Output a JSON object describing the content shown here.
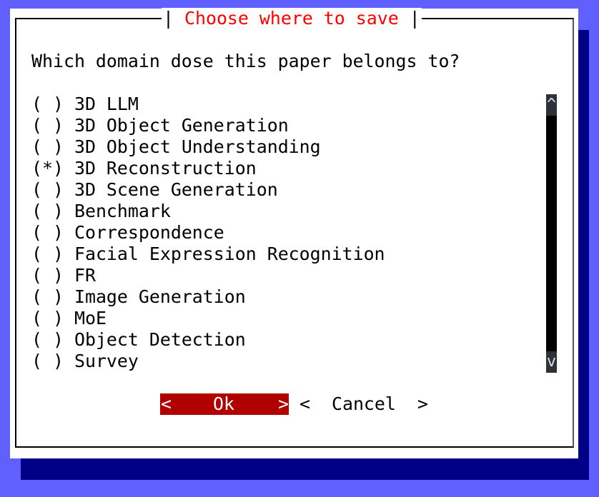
{
  "dialog": {
    "title": "Choose where to save",
    "prompt": "Which domain dose this paper belongs to?",
    "options": [
      {
        "label": "3D LLM",
        "selected": false
      },
      {
        "label": "3D Object Generation",
        "selected": false
      },
      {
        "label": "3D Object Understanding",
        "selected": false
      },
      {
        "label": "3D Reconstruction",
        "selected": true
      },
      {
        "label": "3D Scene Generation",
        "selected": false
      },
      {
        "label": "Benchmark",
        "selected": false
      },
      {
        "label": "Correspondence",
        "selected": false
      },
      {
        "label": "Facial Expression Recognition",
        "selected": false
      },
      {
        "label": "FR",
        "selected": false
      },
      {
        "label": "Image Generation",
        "selected": false
      },
      {
        "label": "MoE",
        "selected": false
      },
      {
        "label": "Object Detection",
        "selected": false
      },
      {
        "label": "Survey",
        "selected": false
      }
    ],
    "scroll_up": "^",
    "scroll_down": "v",
    "ok_label": "Ok",
    "cancel_label": "Cancel"
  },
  "colors": {
    "background": "#6060ff",
    "shadow": "#000087",
    "title": "#ff0000",
    "button_focus": "#b00000"
  }
}
